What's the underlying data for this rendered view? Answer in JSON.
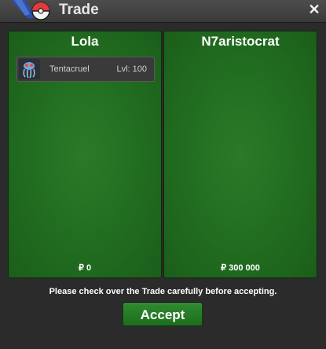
{
  "window": {
    "title": "Trade",
    "close_icon": "close-icon",
    "logo_icon": "game-logo-icon"
  },
  "trade": {
    "left": {
      "player": "Lola",
      "items": [
        {
          "name": "Tentacruel",
          "level": "Lvl: 100",
          "icon": "pokemon-sprite-icon"
        }
      ],
      "money": "₽ 0"
    },
    "right": {
      "player": "N7aristocrat",
      "items": [],
      "money": "₽ 300 000"
    }
  },
  "footer": {
    "notice": "Please check over the Trade carefully before accepting.",
    "accept_label": "Accept"
  },
  "colors": {
    "panel_green": "#226f21",
    "button_green": "#2f8a2f",
    "window_bg": "#2b2b2b"
  }
}
